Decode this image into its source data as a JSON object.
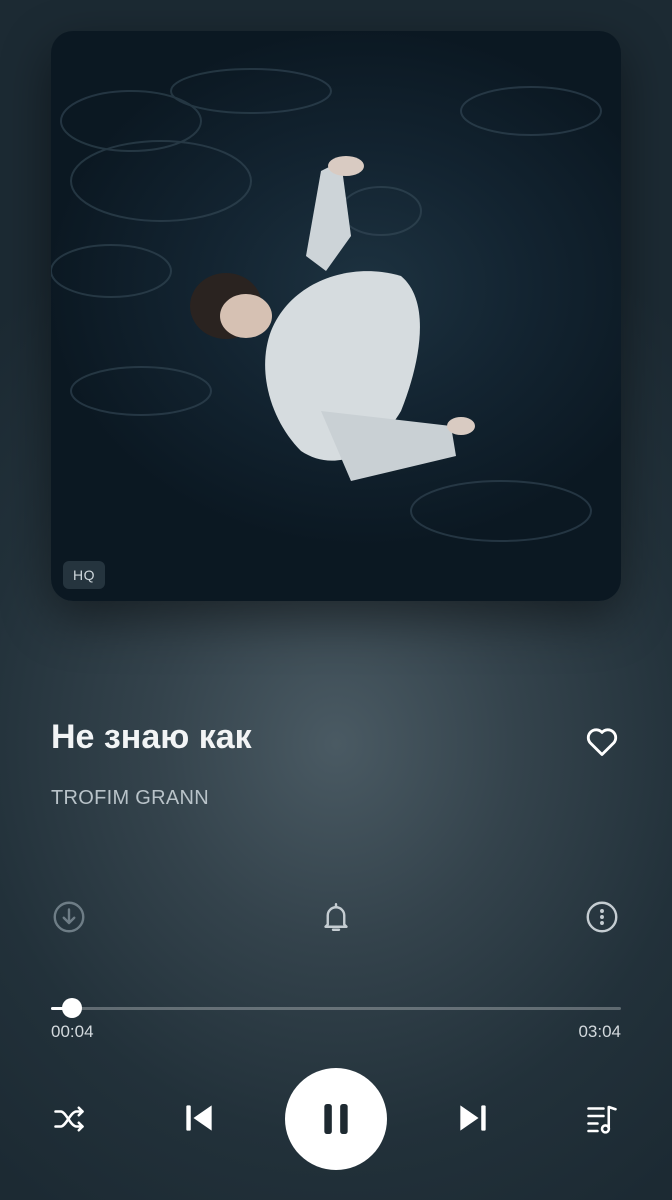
{
  "track": {
    "title": "Не знаю как",
    "artist": "TROFIM GRANN",
    "quality_badge": "HQ"
  },
  "playback": {
    "elapsed": "00:04",
    "duration": "03:04",
    "progress": 0.022
  },
  "icons": {
    "like": "heart-icon",
    "download": "download-icon",
    "notify": "bell-icon",
    "more": "more-icon",
    "shuffle": "shuffle-icon",
    "previous": "previous-icon",
    "pause": "pause-icon",
    "next": "next-icon",
    "queue": "queue-icon"
  },
  "colors": {
    "accent": "#ffffff",
    "background": "#2b3a43",
    "muted": "#b9c3c9"
  }
}
